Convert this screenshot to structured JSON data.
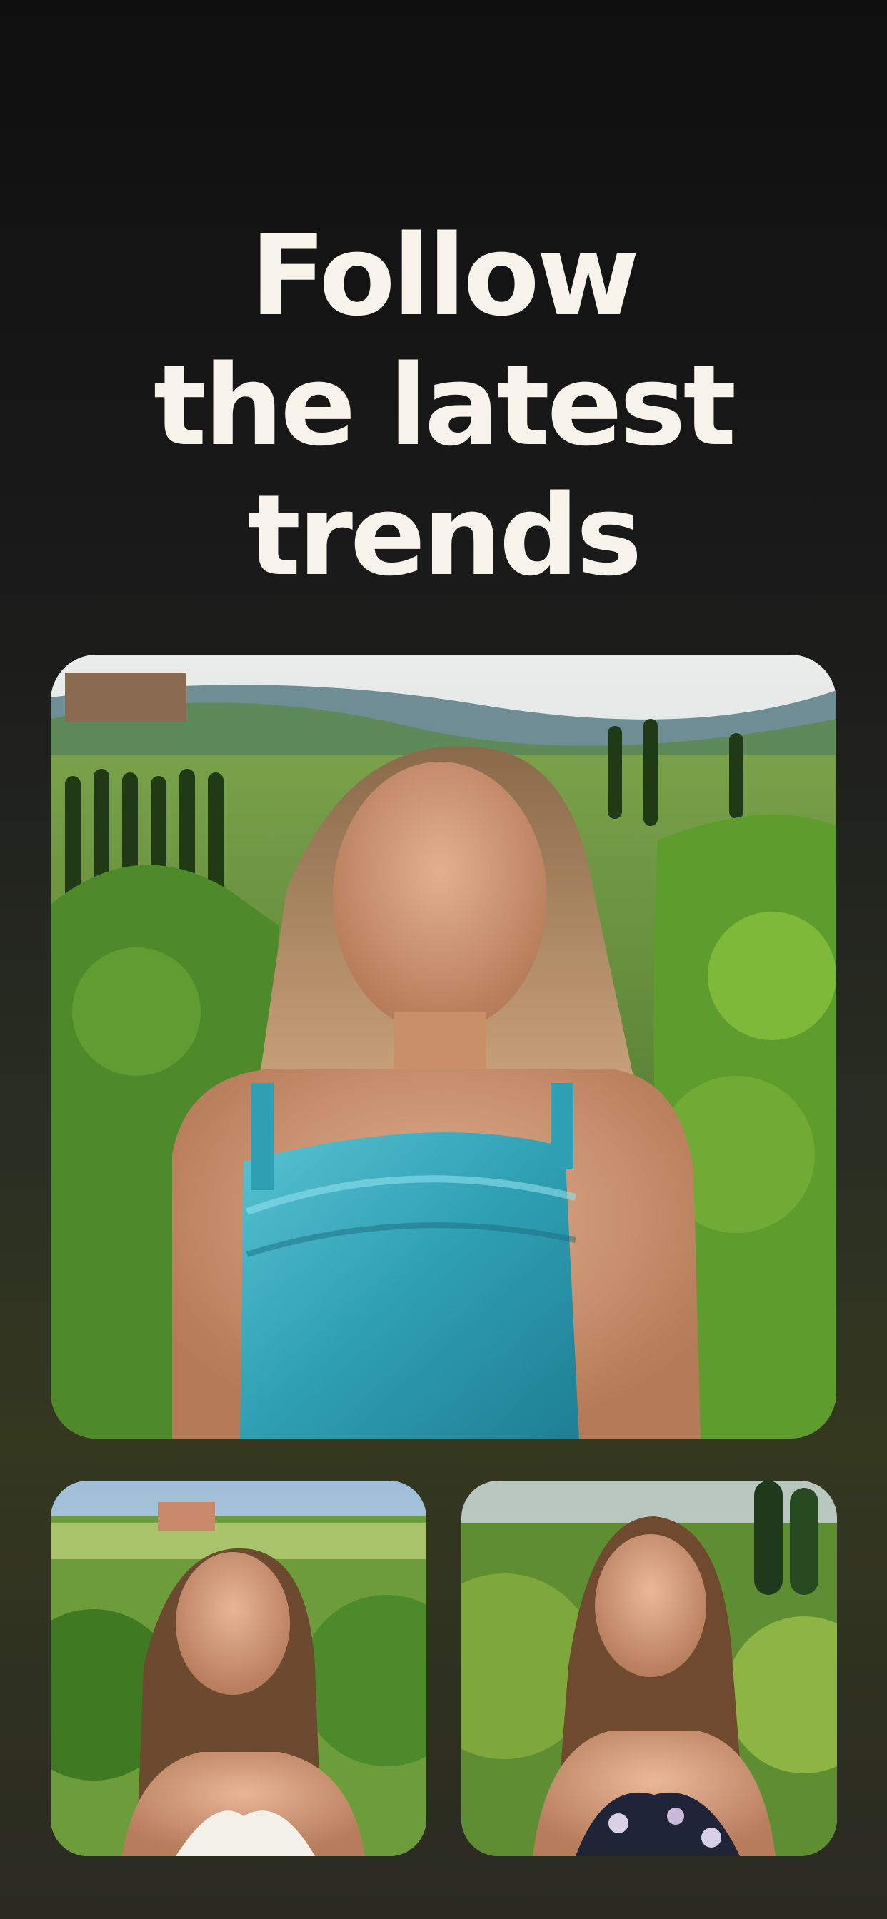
{
  "headline": {
    "line1": "Follow",
    "line2": "the latest",
    "line3": "trends"
  },
  "gallery": {
    "main": {
      "dress_color": "#2fa3b8"
    },
    "left": {
      "dress_color": "#f4f0ea"
    },
    "right": {
      "dress_color": "#1f2438"
    }
  },
  "colors": {
    "text": "#f7f3ea",
    "background_top": "#0f0f0f",
    "background_bottom": "#34381f"
  }
}
